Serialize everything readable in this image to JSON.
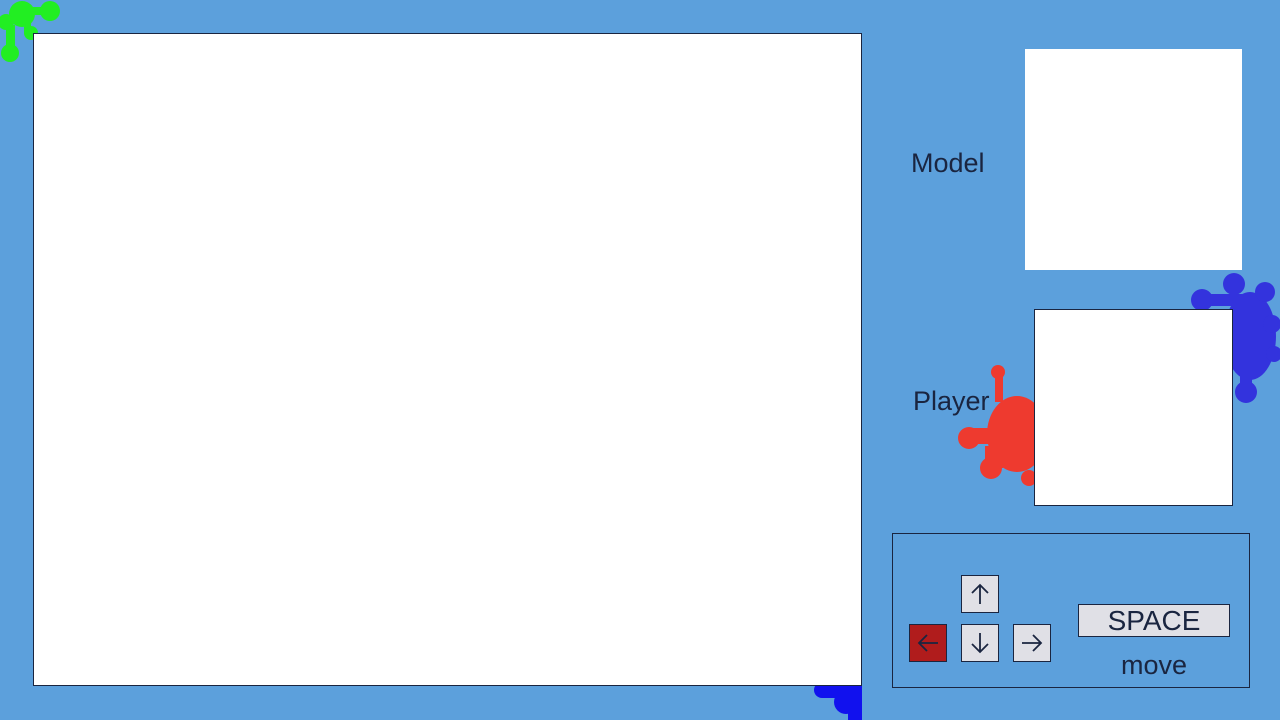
{
  "labels": {
    "model": "Model",
    "player": "Player"
  },
  "controls": {
    "space_key": "SPACE",
    "space_action": "move",
    "arrow_keys": [
      {
        "name": "up",
        "icon": "arrow-up-icon",
        "active": false
      },
      {
        "name": "left",
        "icon": "arrow-left-icon",
        "active": true
      },
      {
        "name": "down",
        "icon": "arrow-down-icon",
        "active": false
      },
      {
        "name": "right",
        "icon": "arrow-right-icon",
        "active": false
      }
    ]
  },
  "colors": {
    "background": "#5ca0dc",
    "active_key": "#b01c1c",
    "splat_green": "#22ee22",
    "splat_blue": "#3333dd",
    "splat_red": "#ee3a2f",
    "splat_deep_blue": "#1111ee"
  }
}
